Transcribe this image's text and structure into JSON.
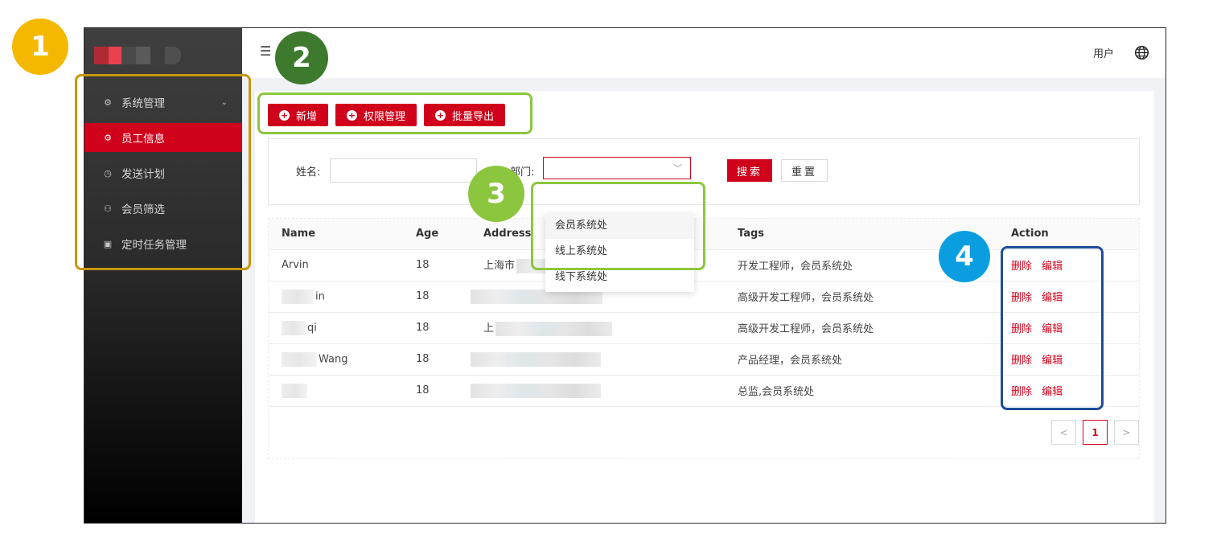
{
  "sidebar": {
    "items": [
      {
        "label": "系统管理",
        "icon": "gear-icon",
        "glyph": "⚙",
        "has_chevron": true
      },
      {
        "label": "员工信息",
        "icon": "gear-icon",
        "glyph": "⚙",
        "active": true
      },
      {
        "label": "发送计划",
        "icon": "clock-icon",
        "glyph": "◷"
      },
      {
        "label": "会员筛选",
        "icon": "user-icon",
        "glyph": "⚇"
      },
      {
        "label": "定时任务管理",
        "icon": "terminal-icon",
        "glyph": "▣"
      }
    ]
  },
  "header": {
    "menu_icon": "☰",
    "user_label": "用户"
  },
  "toolbar": {
    "add_label": "新增",
    "permission_label": "权限管理",
    "export_label": "批量导出"
  },
  "search": {
    "name_label": "姓名:",
    "name_value": "",
    "dept_label": "部门:",
    "dept_value": "",
    "search_label": "搜索",
    "reset_label": "重置"
  },
  "dropdown": {
    "options": [
      "会员系统处",
      "线上系统处",
      "线下系统处"
    ]
  },
  "table": {
    "columns": [
      "Name",
      "Age",
      "Address",
      "Tags",
      "Action"
    ],
    "rows": [
      {
        "name": "Arvin",
        "age": "18",
        "address": "上海市",
        "tags": "开发工程师，会员系统处"
      },
      {
        "name": "in",
        "age": "18",
        "address": "",
        "tags": "高级开发工程师，会员系统处"
      },
      {
        "name": "qi",
        "age": "18",
        "address": "上",
        "tags": "高级开发工程师，会员系统处"
      },
      {
        "name": "Wang",
        "age": "18",
        "address": "",
        "tags": "产品经理，会员系统处"
      },
      {
        "name": "",
        "age": "18",
        "address": "",
        "tags": "总监,会员系统处"
      }
    ],
    "delete_label": "删除",
    "edit_label": "编辑"
  },
  "pagination": {
    "prev": "<",
    "current": "1",
    "next": ">"
  },
  "annotations": {
    "labels": [
      "1",
      "2",
      "3",
      "4"
    ],
    "colors": {
      "1": "#f5b800",
      "2": "#3e7a2e",
      "3": "#8cc63f",
      "4": "#0a9ee0",
      "box1": "#c8960c",
      "box23": "#8cc63f",
      "box4": "#1f4e9a"
    }
  },
  "colors": {
    "accent": "#d0021b"
  }
}
